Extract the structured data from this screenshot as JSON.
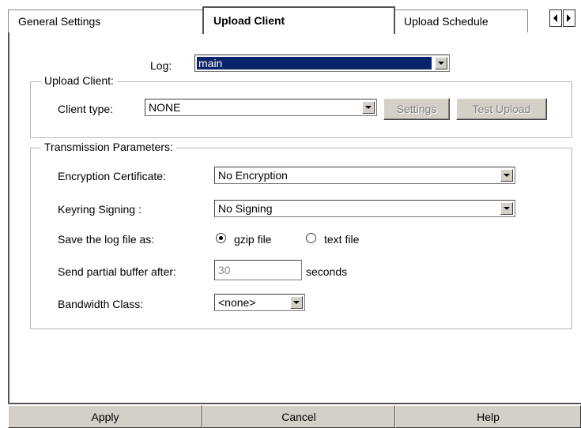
{
  "tabs": [
    {
      "label": "General Settings",
      "active": false
    },
    {
      "label": "Upload Client",
      "active": true
    },
    {
      "label": "Upload Schedule",
      "active": false
    }
  ],
  "log": {
    "label": "Log:",
    "value": "main"
  },
  "upload_client_group": {
    "legend": "Upload Client:",
    "client_type_label": "Client type:",
    "client_type_value": "NONE",
    "settings_button": "Settings",
    "test_upload_button": "Test Upload"
  },
  "transmission_group": {
    "legend": "Transmission Parameters:",
    "encryption_label": "Encryption Certificate:",
    "encryption_value": "No Encryption",
    "keyring_label": "Keyring Signing :",
    "keyring_value": "No Signing",
    "save_as_label": "Save the log file as:",
    "save_as_options": [
      {
        "label": "gzip file",
        "selected": true
      },
      {
        "label": "text file",
        "selected": false
      }
    ],
    "partial_buffer_label": "Send partial buffer after:",
    "partial_buffer_value": "30",
    "partial_buffer_unit": "seconds",
    "bandwidth_label": "Bandwidth Class:",
    "bandwidth_value": "<none>"
  },
  "footer": {
    "apply": "Apply",
    "cancel": "Cancel",
    "help": "Help"
  },
  "colors": {
    "selection": "#0a246a",
    "button_face": "#d4d0c8",
    "disabled_text": "#808080"
  }
}
